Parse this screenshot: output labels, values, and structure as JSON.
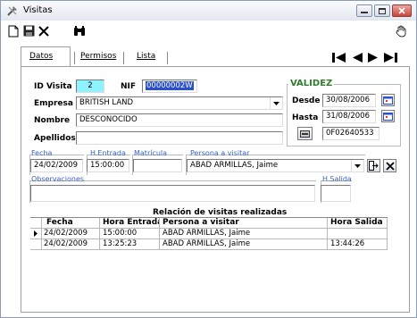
{
  "window": {
    "title": "Visitas",
    "controls": [
      "minimize",
      "maximize",
      "close"
    ]
  },
  "toolbar": {
    "items": [
      {
        "name": "new-document-icon"
      },
      {
        "name": "save-icon"
      },
      {
        "name": "delete-icon"
      },
      {
        "name": "binoculars-icon"
      },
      {
        "name": "hand-pointer-icon"
      }
    ]
  },
  "tabs": [
    {
      "label": "Datos",
      "active": true
    },
    {
      "label": "Permisos",
      "active": false
    },
    {
      "label": "Lista",
      "active": false
    }
  ],
  "nav": [
    "first",
    "previous",
    "next",
    "last"
  ],
  "form": {
    "id_visita_label": "ID Visita",
    "id_visita_value": "2",
    "nif_label": "NIF",
    "nif_value": "00000002W",
    "empresa_label": "Empresa",
    "empresa_value": "BRITISH LAND",
    "nombre_label": "Nombre",
    "nombre_value": "DESCONOCIDO",
    "apellidos_label": "Apellidos",
    "apellidos_value": ""
  },
  "validez": {
    "title": "VALIDEZ",
    "desde_label": "Desde",
    "desde_value": "30/08/2006",
    "hasta_label": "Hasta",
    "hasta_value": "31/08/2006",
    "card_value": "0F02640533"
  },
  "visit_entry": {
    "fecha_label": "Fecha",
    "fecha_value": "24/02/2009",
    "hentrada_label": "H.Entrada",
    "hentrada_value": "15:00:00",
    "matricula_label": "Matrícula",
    "matricula_value": "",
    "persona_label": "Persona a visitar",
    "persona_value": "ABAD ARMILLAS, Jaime",
    "observaciones_label": "Observaciones",
    "observaciones_value": "",
    "hsalida_label": "H.Salida",
    "hsalida_value": ""
  },
  "visits_table": {
    "title": "Relación de visitas realizadas",
    "columns": [
      "Fecha",
      "Hora Entrada",
      "Persona a visitar",
      "Hora Salida"
    ],
    "rows": [
      [
        "24/02/2009",
        "15:00:00",
        "ABAD ARMILLAS, Jaime",
        ""
      ],
      [
        "24/02/2009",
        "13:25:23",
        "ABAD ARMILLAS, Jaime",
        "13:44:26"
      ]
    ],
    "current_row": 0
  },
  "colors": {
    "id_field_bg": "#8ff2ff",
    "selection": "#2a4fd0",
    "validez_title": "#2d7d2d",
    "subfield_label": "#3a62c4"
  }
}
